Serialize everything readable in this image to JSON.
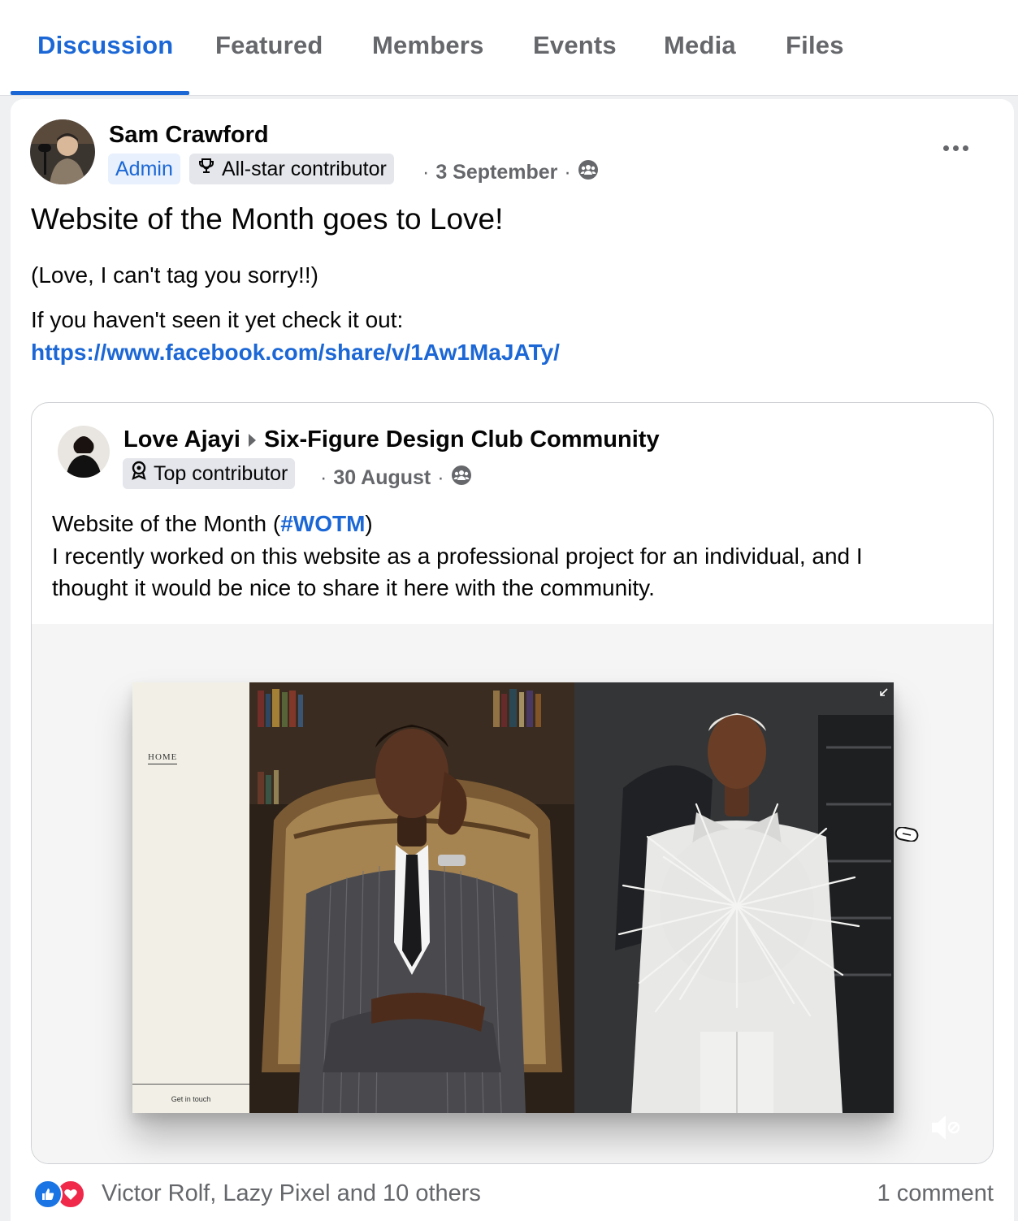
{
  "tabs": [
    {
      "label": "Discussion",
      "active": true
    },
    {
      "label": "Featured"
    },
    {
      "label": "Members"
    },
    {
      "label": "Events"
    },
    {
      "label": "Media"
    },
    {
      "label": "Files"
    }
  ],
  "post": {
    "author": "Sam Crawford",
    "badges": {
      "admin": "Admin",
      "contributor": "All-star contributor"
    },
    "date": "3 September",
    "privacy_icon": "group-icon",
    "title": "Website of the Month goes to Love!",
    "line1": "(Love, I can't tag you sorry!!)",
    "line2": "If you haven't seen it yet check it out:",
    "link": "https://www.facebook.com/share/v/1Aw1MaJATy/"
  },
  "shared_post": {
    "author": "Love Ajayi",
    "group": "Six-Figure Design Club Community",
    "badge": "Top contributor",
    "date": "30 August",
    "text_prefix": "Website of the Month (",
    "hashtag": "#WOTM",
    "text_suffix": ")",
    "line2": "I recently worked on this website as a professional project for an individual, and I",
    "line3": "thought it would be nice to share it here with the community.",
    "website": {
      "nav_home": "HOME",
      "cta": "Get in touch"
    }
  },
  "footer": {
    "reactions_text": "Victor Rolf, Lazy Pixel and 10 others",
    "comments": "1 comment"
  },
  "colors": {
    "accent": "#1b67d6",
    "muted": "#65676b",
    "like": "#1b74e4",
    "love": "#f0284a"
  }
}
